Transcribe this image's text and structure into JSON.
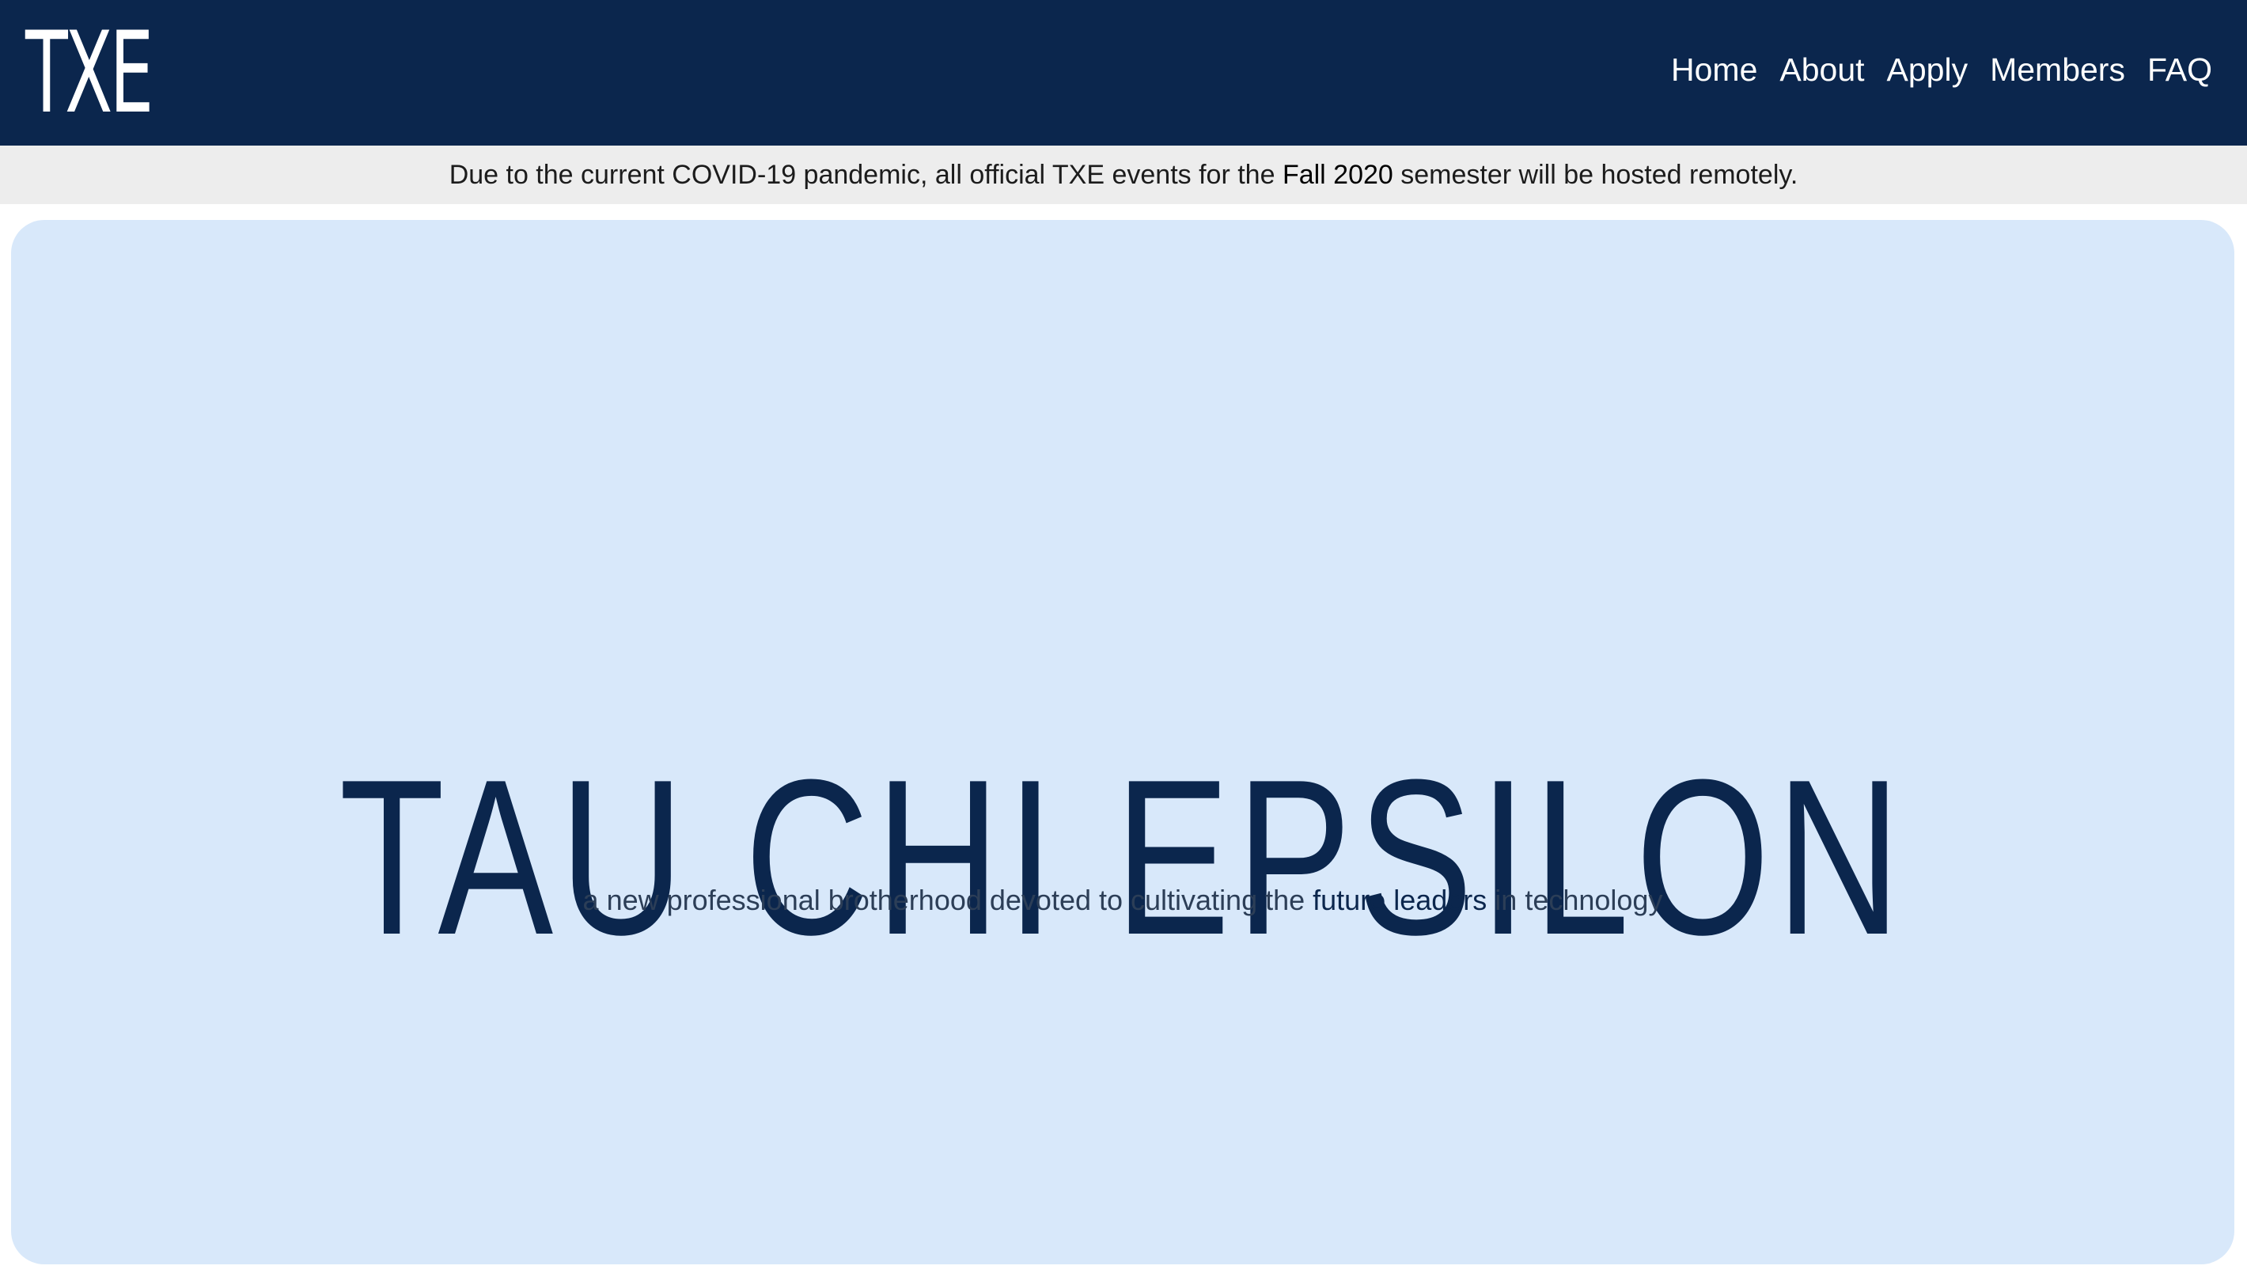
{
  "header": {
    "logo_text": "TXE",
    "nav": [
      {
        "label": "Home"
      },
      {
        "label": "About"
      },
      {
        "label": "Apply"
      },
      {
        "label": "Members"
      },
      {
        "label": "FAQ"
      }
    ]
  },
  "notice": {
    "text_before": "Due to the current COVID-19 pandemic, all official TXE events for the ",
    "highlight": "Fall 2020",
    "text_after": " semester will be hosted remotely."
  },
  "hero": {
    "title": "TAU CHI EPSILON",
    "subtitle_before": "a new professional brotherhood devoted to cultivating the ",
    "subtitle_highlight": "future leaders",
    "subtitle_after": " in technology"
  },
  "colors": {
    "navbar": "#0b264d",
    "notice_bg": "#ededed",
    "hero_bg": "#d8e8fa",
    "title": "#0b264d"
  }
}
